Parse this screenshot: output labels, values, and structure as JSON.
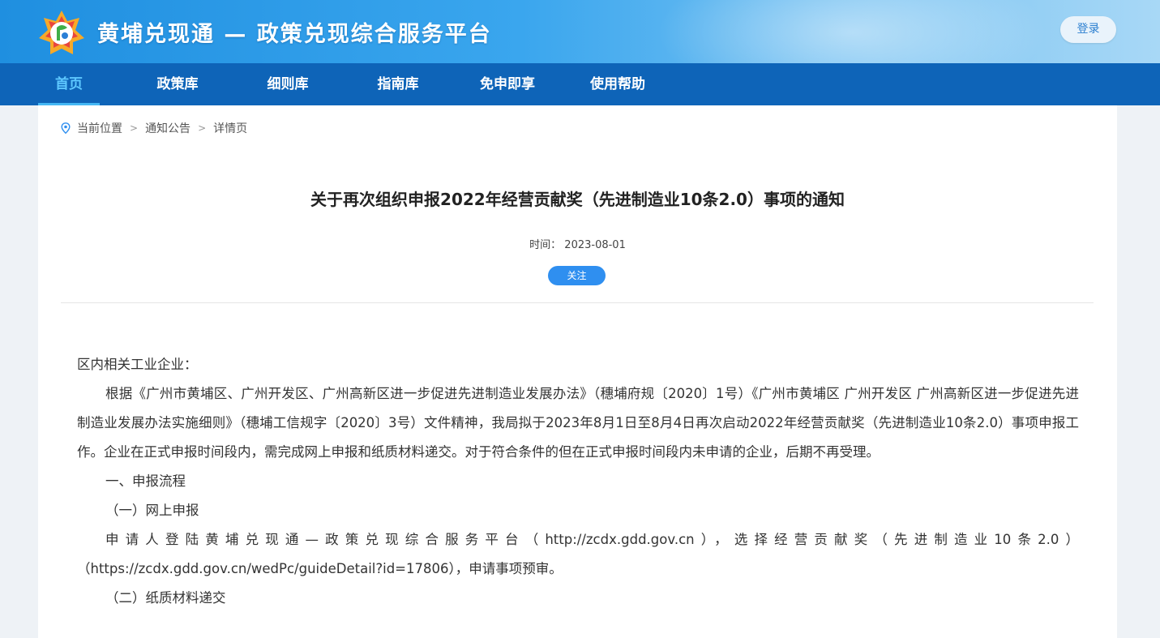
{
  "header": {
    "site_title": "黄埔兑现通 — 政策兑现综合服务平台",
    "login_label": "登录",
    "logo_icon": "brand-logo-icon"
  },
  "nav": {
    "items": [
      {
        "label": "首页",
        "active": true
      },
      {
        "label": "政策库",
        "active": false
      },
      {
        "label": "细则库",
        "active": false
      },
      {
        "label": "指南库",
        "active": false
      },
      {
        "label": "免申即享",
        "active": false
      },
      {
        "label": "使用帮助",
        "active": false
      }
    ]
  },
  "breadcrumb": {
    "icon": "location-pin-icon",
    "items": [
      "当前位置",
      "通知公告",
      "详情页"
    ],
    "separator": ">"
  },
  "article": {
    "title": "关于再次组织申报2022年经营贡献奖（先进制造业10条2.0）事项的通知",
    "time_label": "时间：",
    "time_value": "2023-08-01",
    "follow_label": "关注",
    "paragraphs": {
      "p1": "区内相关工业企业：",
      "p2": "根据《广州市黄埔区、广州开发区、广州高新区进一步促进先进制造业发展办法》（穗埔府规〔2020〕1号）《广州市黄埔区 广州开发区 广州高新区进一步促进先进制造业发展办法实施细则》（穗埔工信规字〔2020〕3号）文件精神，我局拟于2023年8月1日至8月4日再次启动2022年经营贡献奖（先进制造业10条2.0）事项申报工作。企业在正式申报时间段内，需完成网上申报和纸质材料递交。对于符合条件的但在正式申报时间段内未申请的企业，后期不再受理。",
      "p3": "一、申报流程",
      "p4": "（一）网上申报",
      "p5": "申请人登陆黄埔兑现通—政策兑现综合服务平台（http://zcdx.gdd.gov.cn），选择经营贡献奖（先进制造业10条2.0）",
      "p6": "（https://zcdx.gdd.gov.cn/wedPc/guideDetail?id=17806），申请事项预审。",
      "p7": "（二）纸质材料递交"
    }
  },
  "colors": {
    "header_gradient_start": "#1f8fe0",
    "nav_bg": "#0e64b8",
    "nav_active": "#5ec8ff",
    "follow_btn": "#2f8ff0"
  }
}
